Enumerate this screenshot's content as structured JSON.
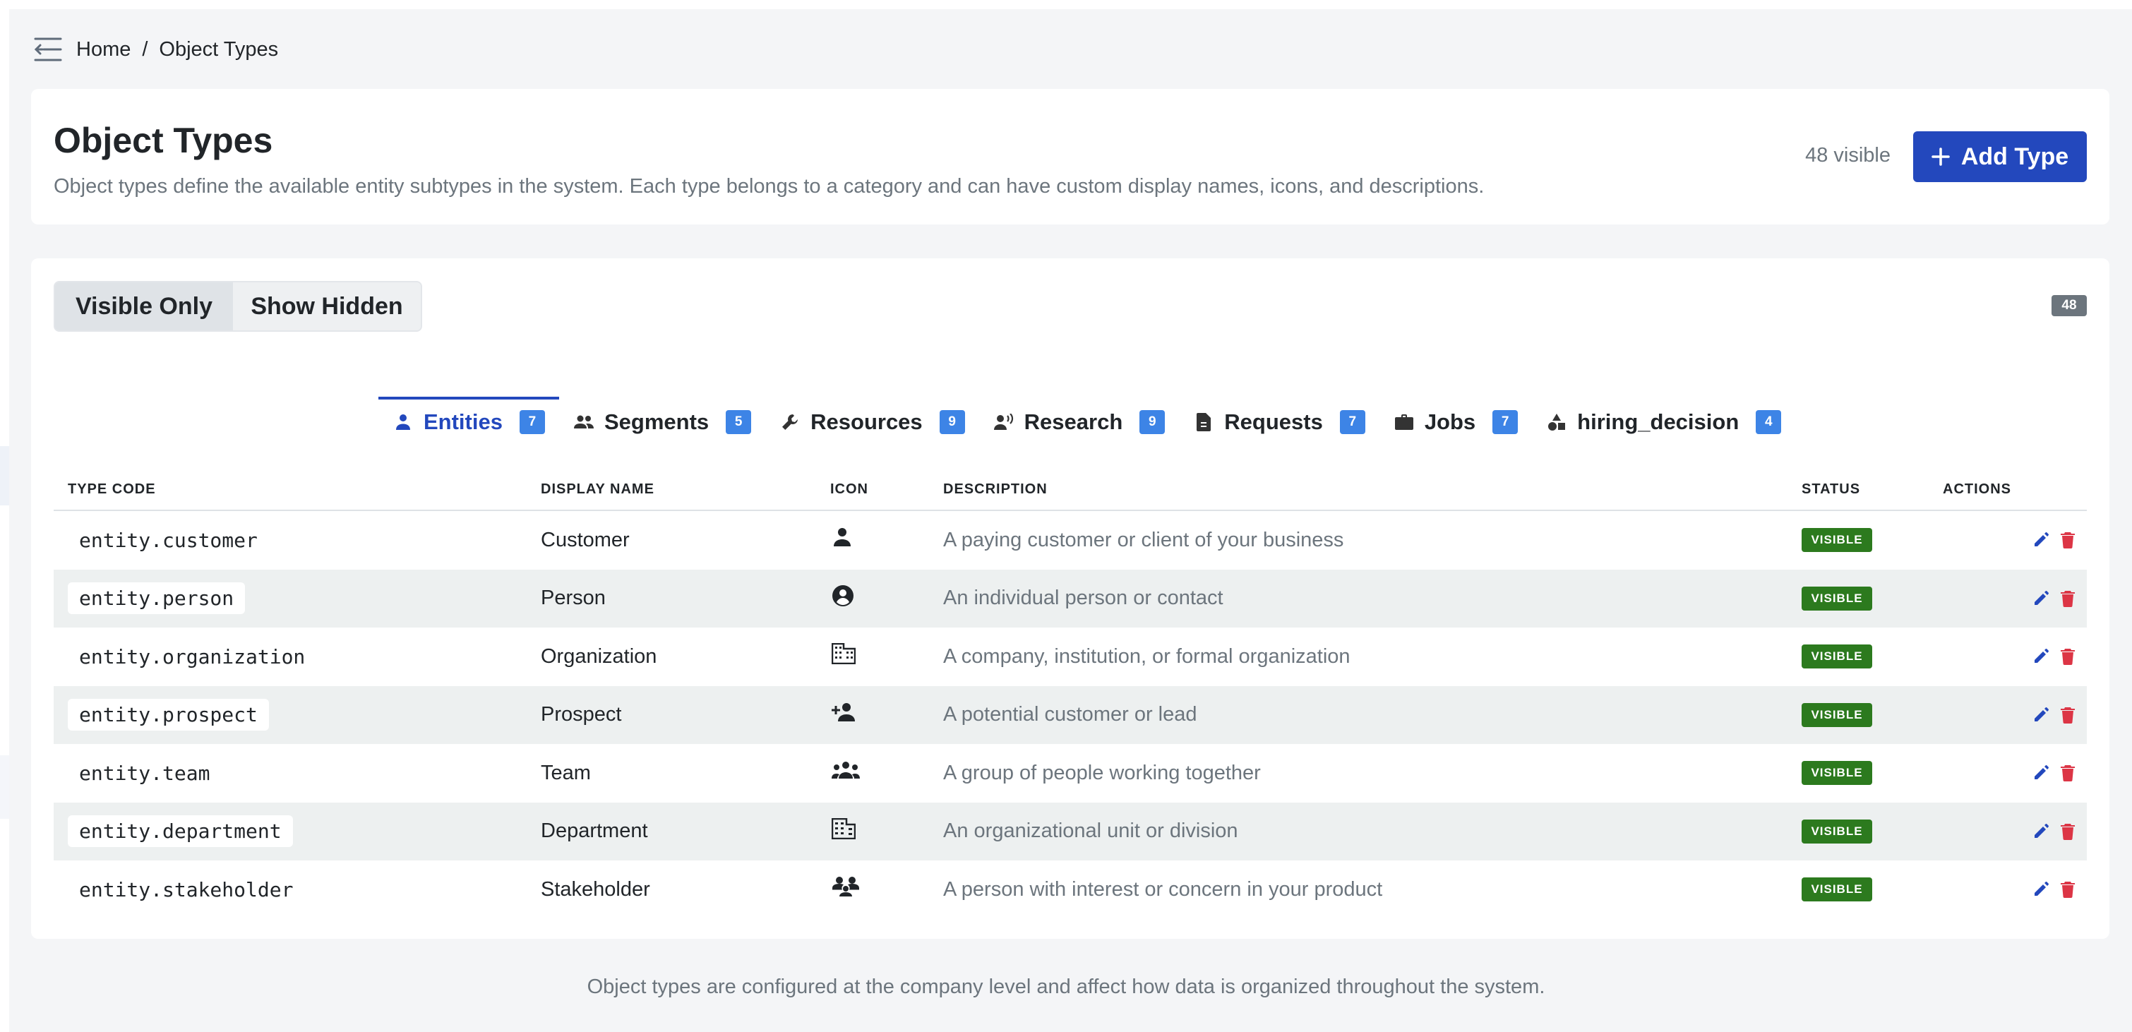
{
  "breadcrumb": {
    "home": "Home",
    "separator": "/",
    "current": "Object Types"
  },
  "header": {
    "title": "Object Types",
    "subtitle": "Object types define the available entity subtypes in the system. Each type belongs to a category and can have custom display names, icons, and descriptions.",
    "visible_count": "48 visible",
    "add_button": "Add Type"
  },
  "filters": {
    "visible_only": "Visible Only",
    "show_hidden": "Show Hidden",
    "total_badge": "48"
  },
  "tabs": [
    {
      "label": "Entities",
      "count": "7",
      "icon": "person-icon",
      "active": true
    },
    {
      "label": "Segments",
      "count": "5",
      "icon": "group-icon",
      "active": false
    },
    {
      "label": "Resources",
      "count": "9",
      "icon": "wrench-icon",
      "active": false
    },
    {
      "label": "Research",
      "count": "9",
      "icon": "voice-icon",
      "active": false
    },
    {
      "label": "Requests",
      "count": "7",
      "icon": "document-icon",
      "active": false
    },
    {
      "label": "Jobs",
      "count": "7",
      "icon": "briefcase-icon",
      "active": false
    },
    {
      "label": "hiring_decision",
      "count": "4",
      "icon": "shapes-icon",
      "active": false
    }
  ],
  "table": {
    "columns": {
      "type_code": "TYPE CODE",
      "display_name": "DISPLAY NAME",
      "icon": "ICON",
      "description": "DESCRIPTION",
      "status": "STATUS",
      "actions": "ACTIONS"
    },
    "rows": [
      {
        "code": "entity.customer",
        "name": "Customer",
        "icon": "person-icon",
        "description": "A paying customer or client of your business",
        "status": "VISIBLE"
      },
      {
        "code": "entity.person",
        "name": "Person",
        "icon": "account-circle-icon",
        "description": "An individual person or contact",
        "status": "VISIBLE"
      },
      {
        "code": "entity.organization",
        "name": "Organization",
        "icon": "building-icon",
        "description": "A company, institution, or formal organization",
        "status": "VISIBLE"
      },
      {
        "code": "entity.prospect",
        "name": "Prospect",
        "icon": "person-add-icon",
        "description": "A potential customer or lead",
        "status": "VISIBLE"
      },
      {
        "code": "entity.team",
        "name": "Team",
        "icon": "groups-icon",
        "description": "A group of people working together",
        "status": "VISIBLE"
      },
      {
        "code": "entity.department",
        "name": "Department",
        "icon": "office-building-icon",
        "description": "An organizational unit or division",
        "status": "VISIBLE"
      },
      {
        "code": "entity.stakeholder",
        "name": "Stakeholder",
        "icon": "diversity-icon",
        "description": "A person with interest or concern in your product",
        "status": "VISIBLE"
      }
    ]
  },
  "footer": {
    "note": "Object types are configured at the company level and affect how data is organized throughout the system."
  },
  "colors": {
    "primary": "#2348bd",
    "tab_badge": "#3d84e6",
    "status_visible": "#2c7a1e",
    "delete": "#dc3545",
    "muted": "#6c757d"
  }
}
